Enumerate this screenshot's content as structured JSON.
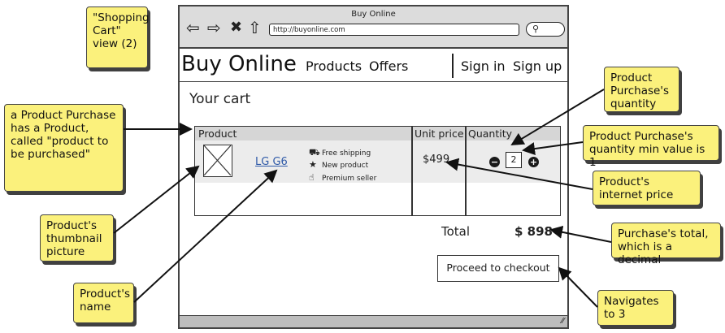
{
  "notes": {
    "shopping_cart_view": "\"Shopping Cart\" view (2)",
    "product_purchase": "a Product Purchase has a Product, called \"product to be purchased\"",
    "thumbnail": "Product's thumbnail picture",
    "product_name": "Product's name",
    "quantity": "Product Purchase's quantity",
    "quantity_min": "Product Purchase's quantity min value is 1",
    "internet_price": "Product's internet price",
    "total_decimal": "Purchase's total, which is a decimal",
    "navigates": "Navigates to 3"
  },
  "window": {
    "title": "Buy Online",
    "url": "http://buyonline.com"
  },
  "header": {
    "brand": "Buy Online",
    "nav": [
      "Products",
      "Offers"
    ],
    "auth": [
      "Sign in",
      "Sign up"
    ]
  },
  "cart": {
    "title": "Your cart",
    "columns": [
      "Product",
      "Unit price",
      "Quantity"
    ],
    "item": {
      "name": "LG G6",
      "features": [
        "Free shipping",
        "New product",
        "Premium seller"
      ],
      "unit_price": "$499",
      "quantity": "2"
    },
    "total_label": "Total",
    "total_value": "$ 898",
    "checkout_label": "Proceed to checkout"
  },
  "icons": [
    "back-arrow-icon",
    "forward-arrow-icon",
    "stop-icon",
    "home-icon",
    "search-icon",
    "truck-icon",
    "star-icon",
    "thumbs-up-icon",
    "minus-icon",
    "plus-icon",
    "image-placeholder-icon",
    "resize-grip-icon"
  ]
}
